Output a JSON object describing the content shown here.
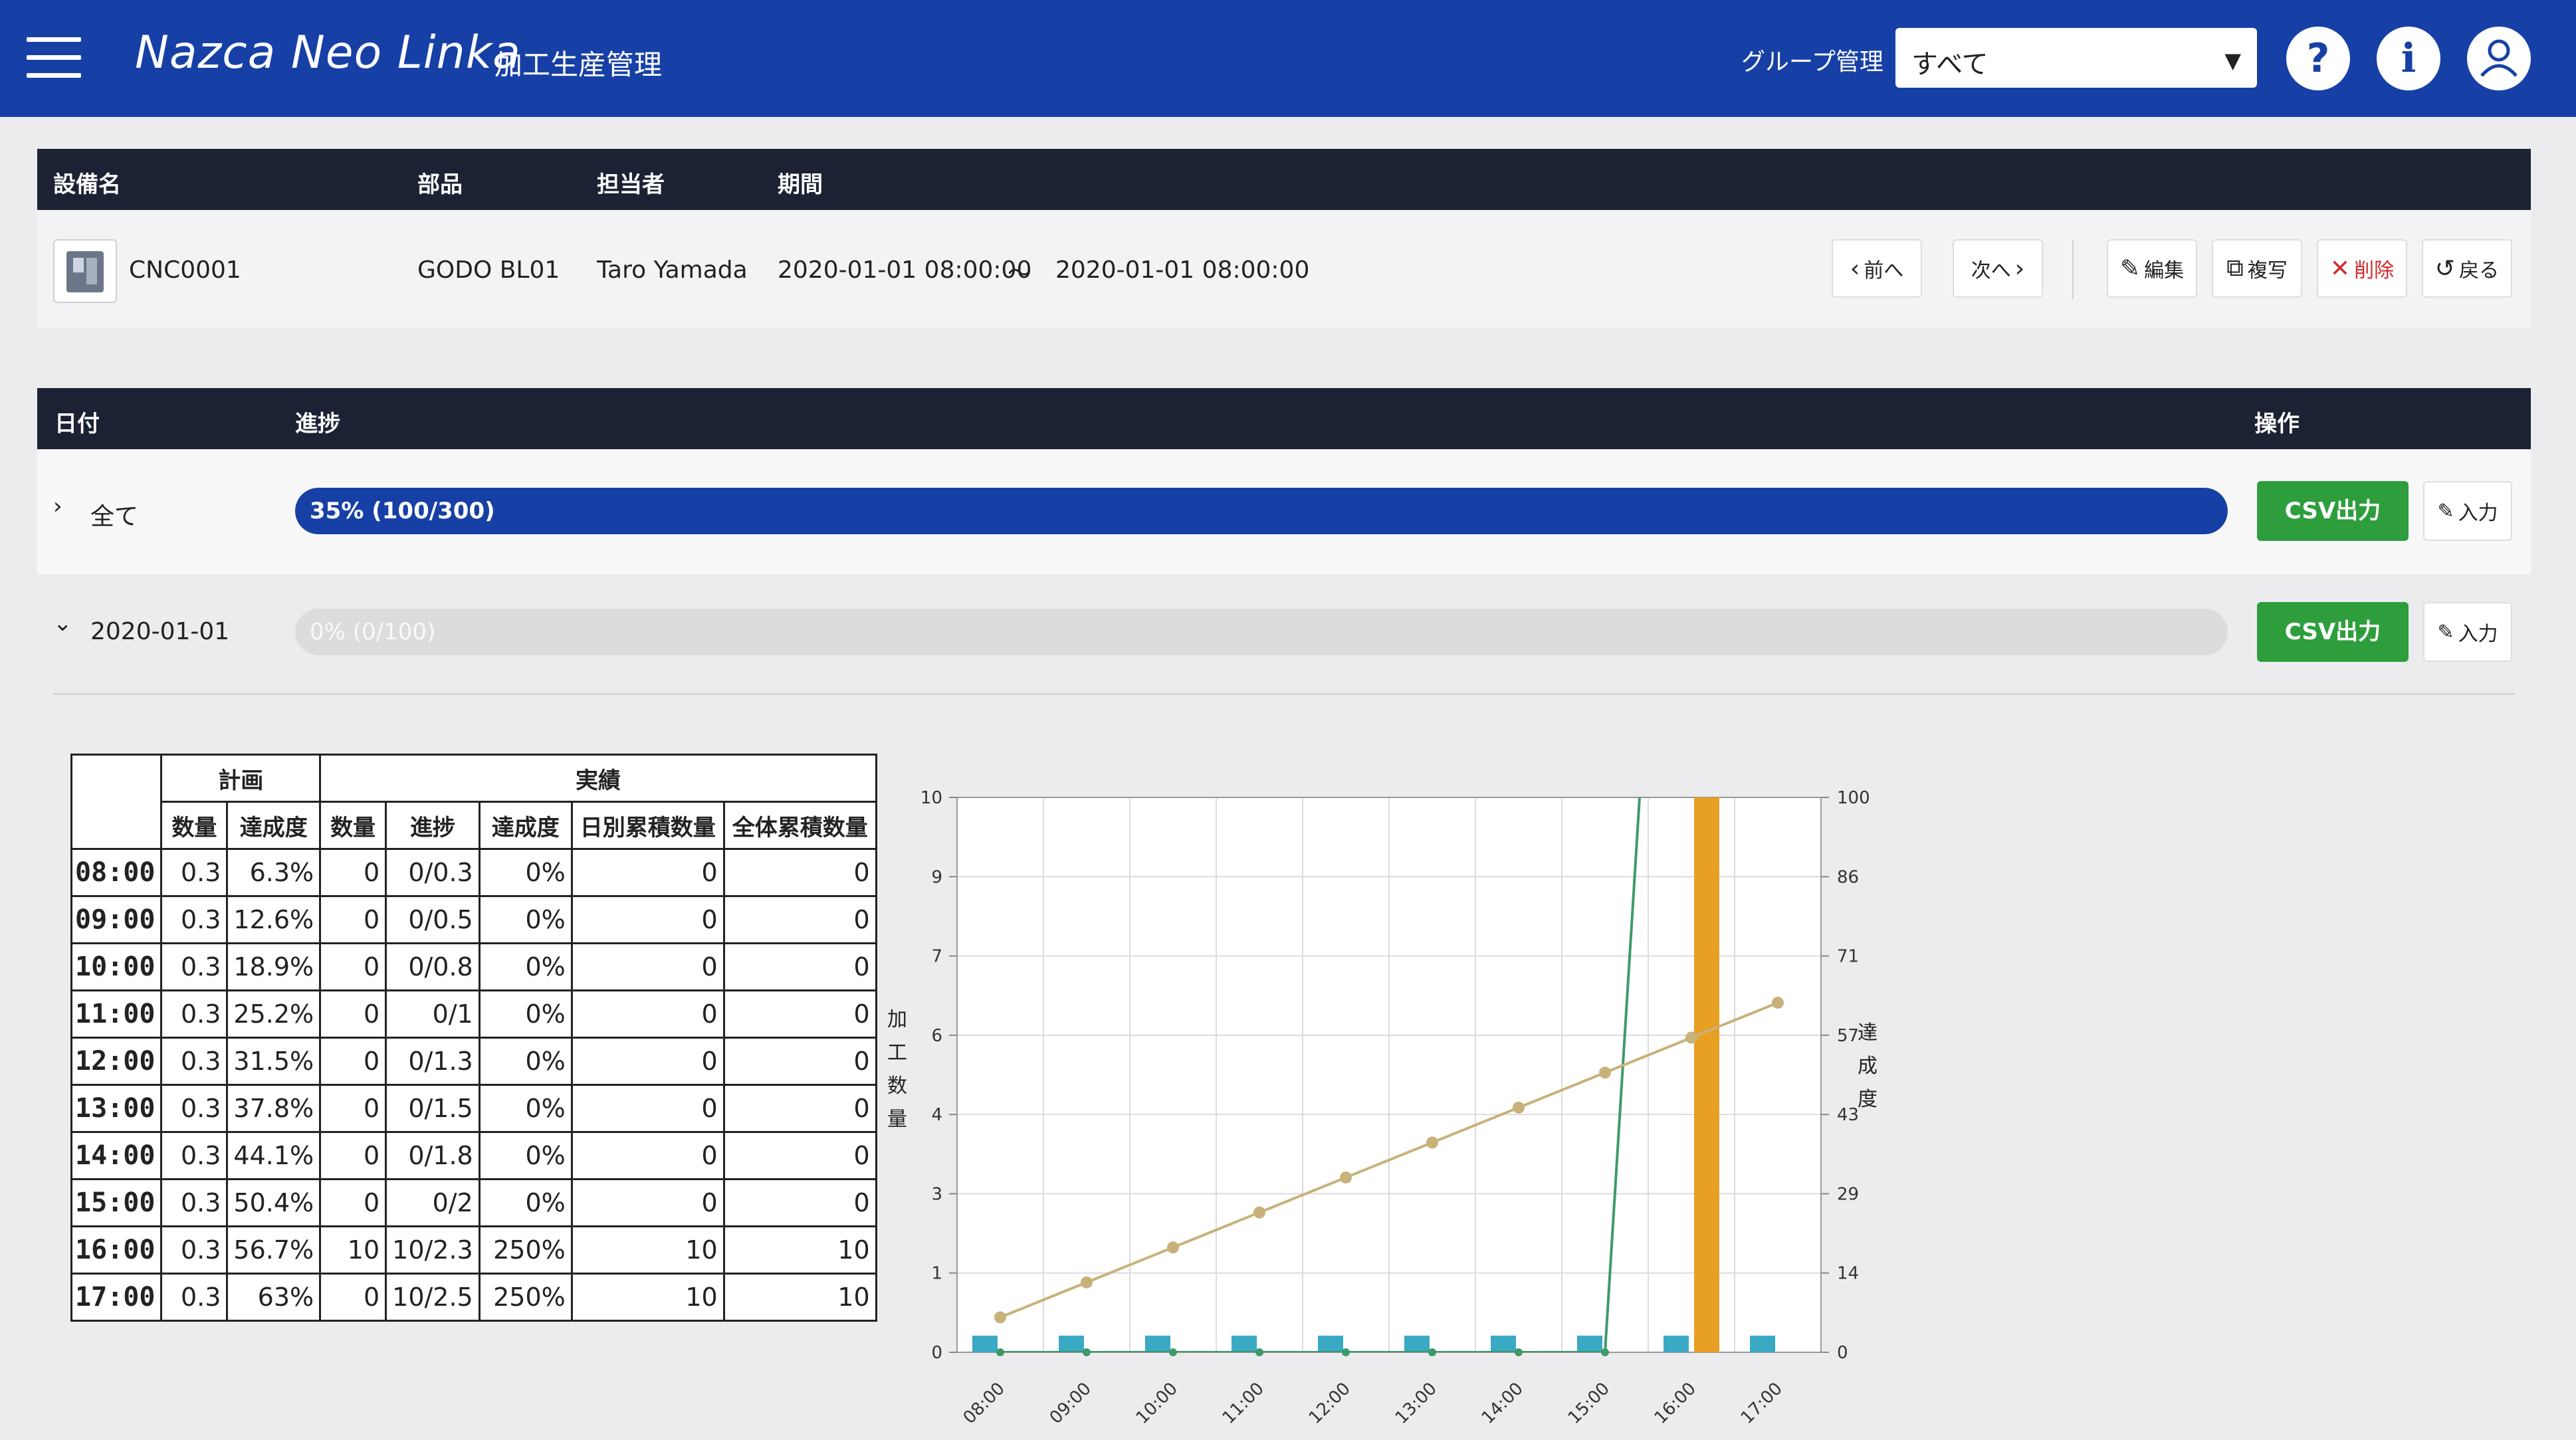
{
  "header": {
    "app_title": "Nazca Neo Linka",
    "module": "加工生産管理",
    "group_label": "グループ管理",
    "group_value": "すべて",
    "help_icon": "?",
    "info_icon": "i"
  },
  "record": {
    "columns": [
      "設備名",
      "部品",
      "担当者",
      "期間"
    ],
    "machine": "CNC0001",
    "part": "GODO BL01",
    "person": "Taro Yamada",
    "period_from": "2020-01-01 08:00:00",
    "period_sep": "〜",
    "period_to": "2020-01-01 08:00:00"
  },
  "toolbar": {
    "prev": "前へ",
    "next": "次へ",
    "edit": "編集",
    "copy": "複写",
    "delete": "削除",
    "back": "戻る"
  },
  "progress_header": {
    "date": "日付",
    "progress": "進捗",
    "ops": "操作"
  },
  "rows": [
    {
      "toggle": "›",
      "label": "全て",
      "bar_text": "35% (100/300)",
      "fill": 1.0,
      "csv": "CSV出力",
      "input": "入力"
    },
    {
      "toggle": "⌄",
      "label": "2020-01-01",
      "bar_text": "0% (0/100)",
      "fill": 0.0,
      "csv": "CSV出力",
      "input": "入力"
    }
  ],
  "table": {
    "group_plan": "計画",
    "group_actual": "実績",
    "headers": [
      "数量",
      "達成度",
      "数量",
      "進捗",
      "達成度",
      "日別累積数量",
      "全体累積数量"
    ],
    "rows": [
      [
        "08:00",
        "0.3",
        "6.3%",
        "0",
        "0/0.3",
        "0%",
        "0",
        "0"
      ],
      [
        "09:00",
        "0.3",
        "12.6%",
        "0",
        "0/0.5",
        "0%",
        "0",
        "0"
      ],
      [
        "10:00",
        "0.3",
        "18.9%",
        "0",
        "0/0.8",
        "0%",
        "0",
        "0"
      ],
      [
        "11:00",
        "0.3",
        "25.2%",
        "0",
        "0/1",
        "0%",
        "0",
        "0"
      ],
      [
        "12:00",
        "0.3",
        "31.5%",
        "0",
        "0/1.3",
        "0%",
        "0",
        "0"
      ],
      [
        "13:00",
        "0.3",
        "37.8%",
        "0",
        "0/1.5",
        "0%",
        "0",
        "0"
      ],
      [
        "14:00",
        "0.3",
        "44.1%",
        "0",
        "0/1.8",
        "0%",
        "0",
        "0"
      ],
      [
        "15:00",
        "0.3",
        "50.4%",
        "0",
        "0/2",
        "0%",
        "0",
        "0"
      ],
      [
        "16:00",
        "0.3",
        "56.7%",
        "10",
        "10/2.3",
        "250%",
        "10",
        "10"
      ],
      [
        "17:00",
        "0.3",
        "63%",
        "0",
        "10/2.5",
        "250%",
        "10",
        "10"
      ]
    ]
  },
  "chart_data": {
    "type": "bar",
    "categories": [
      "08:00",
      "09:00",
      "10:00",
      "11:00",
      "12:00",
      "13:00",
      "14:00",
      "15:00",
      "16:00",
      "17:00"
    ],
    "ylabel": "加工数量",
    "y2label": "達成度",
    "ylim": [
      0,
      10
    ],
    "y2lim": [
      0,
      100
    ],
    "y_ticks": [
      "0",
      "1",
      "3",
      "4",
      "6",
      "7",
      "9",
      "10"
    ],
    "y2_ticks": [
      "0",
      "14",
      "29",
      "43",
      "57",
      "71",
      "86",
      "100"
    ],
    "plan_qty": [
      0.3,
      0.3,
      0.3,
      0.3,
      0.3,
      0.3,
      0.3,
      0.3,
      0.3,
      0.3
    ],
    "actual_qty": [
      0,
      0,
      0,
      0,
      0,
      0,
      0,
      0,
      10,
      0
    ],
    "plan_achievement": [
      6.3,
      12.6,
      18.9,
      25.2,
      31.5,
      37.8,
      44.1,
      50.4,
      56.7,
      63
    ],
    "actual_achievement": [
      0,
      0,
      0,
      0,
      0,
      0,
      0,
      0,
      250,
      250
    ],
    "colors": {
      "plan_bar": "#3aa9c4",
      "actual_bar": "#e8a024",
      "plan_line": "#c8b27a",
      "actual_line": "#3f9a6a"
    },
    "grid": true
  }
}
